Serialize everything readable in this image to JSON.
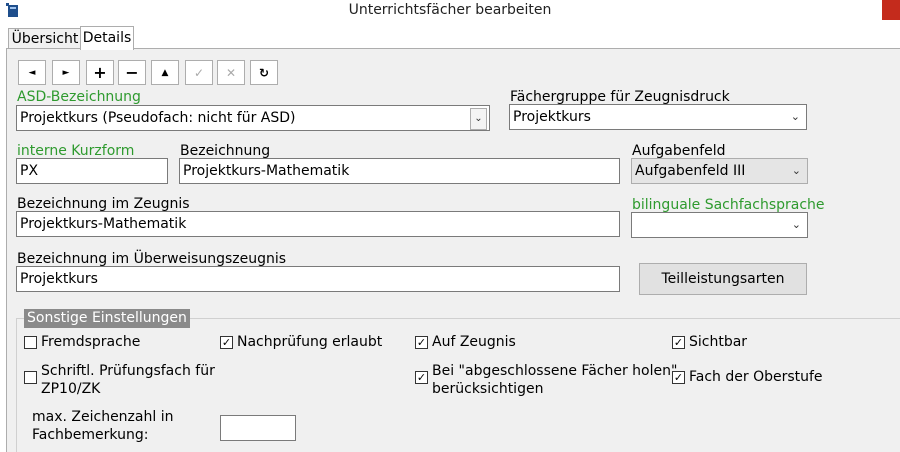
{
  "window": {
    "title": "Unterrichtsfächer bearbeiten"
  },
  "tabs": {
    "overview": "Übersicht",
    "details": "Details"
  },
  "toolbar": {
    "prev": "◄",
    "next": "►",
    "add": "+",
    "remove": "−",
    "up": "▲",
    "confirm": "✓",
    "cancel": "✕",
    "refresh": "↻"
  },
  "form": {
    "asd_label": "ASD-Bezeichnung",
    "asd_value": "Projektkurs (Pseudofach: nicht für ASD)",
    "faechergruppe_label": "Fächergruppe für Zeugnisdruck",
    "faechergruppe_value": "Projektkurs",
    "kurzform_label": "interne Kurzform",
    "kurzform_value": "PX",
    "bezeichnung_label": "Bezeichnung",
    "bezeichnung_value": "Projektkurs-Mathematik",
    "aufgabenfeld_label": "Aufgabenfeld",
    "aufgabenfeld_value": "Aufgabenfeld III",
    "zeugnis_label": "Bezeichnung im Zeugnis",
    "zeugnis_value": "Projektkurs-Mathematik",
    "bilingual_label": "bilinguale Sachfachsprache",
    "bilingual_value": "",
    "ueberweisung_label": "Bezeichnung im Überweisungszeugnis",
    "ueberweisung_value": "Projektkurs",
    "teilleistung_button": "Teilleistungsarten"
  },
  "sonstige": {
    "title": "Sonstige Einstellungen",
    "fremdsprache": {
      "label": "Fremdsprache",
      "checked": false
    },
    "nachpruefung": {
      "label": "Nachprüfung erlaubt",
      "checked": true
    },
    "auf_zeugnis": {
      "label": "Auf Zeugnis",
      "checked": true
    },
    "sichtbar": {
      "label": "Sichtbar",
      "checked": true
    },
    "pruefungsfach": {
      "label_line1": "Schriftl. Prüfungsfach für",
      "label_line2": "ZP10/ZK",
      "checked": false
    },
    "abgeschlossen": {
      "label_line1": "Bei \"abgeschlossene Fächer holen\"",
      "label_line2": "berücksichtigen",
      "checked": true
    },
    "oberstufe": {
      "label": "Fach der Oberstufe",
      "checked": true
    },
    "max_zeichen": {
      "label_line1": "max. Zeichenzahl in",
      "label_line2": "Fachbemerkung:",
      "value": ""
    }
  }
}
